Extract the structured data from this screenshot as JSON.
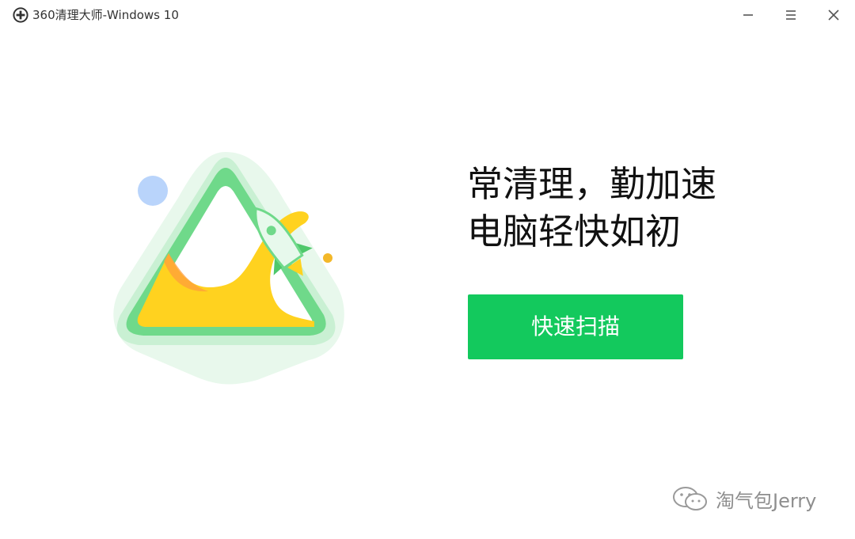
{
  "window": {
    "title": "360清理大师-Windows 10",
    "app_icon": "plus-circle-icon",
    "buttons": {
      "minimize_icon": "minimize-icon",
      "menu_icon": "hamburger-menu-icon",
      "close_icon": "close-icon"
    }
  },
  "main": {
    "headline_line1": "常清理，勤加速",
    "headline_line2": "电脑轻快如初",
    "scan_button_label": "快速扫描",
    "illustration_icon": "rocket-triangle-illustration"
  },
  "watermark": {
    "icon": "wechat-official-account-icon",
    "text": "淘气包Jerry"
  },
  "colors": {
    "accent_green": "#13c95d",
    "illustration_green": "#6fd98a",
    "illustration_yellow": "#ffd21f",
    "background": "#ffffff"
  }
}
